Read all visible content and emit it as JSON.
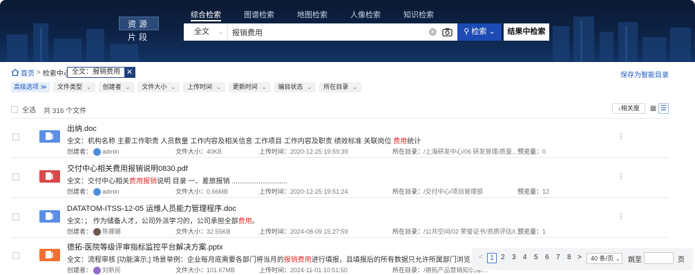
{
  "mode_toggle": [
    "资源",
    "片段"
  ],
  "search_tabs": [
    "综合检索",
    "图谱检索",
    "地图检索",
    "人像检索",
    "知识检索"
  ],
  "search": {
    "scope": "全文",
    "query": "报销费用",
    "button": "检索",
    "in_results": "结果中检索"
  },
  "breadcrumb": {
    "home": "首页",
    "sep": ">",
    "center": "检索中心"
  },
  "query_tag": "全文：报销费用",
  "save_smart": "保存为智能目录",
  "filters": {
    "advanced": "高级选项 ≫",
    "items": [
      "文件类型",
      "创建者",
      "文件大小",
      "上传时间",
      "更新时间",
      "编目状态",
      "所在目录"
    ]
  },
  "list_head": {
    "select_all": "全选",
    "count": "共 316 个文件",
    "sort": "相关度"
  },
  "rows": [
    {
      "type": "word",
      "title": "出纳.doc",
      "snip_pre": "全文：机构名称 主要工作职责 人员数量 工作内容及相关信息 工作项目 工作内容及职责 绩效标准 关联岗位 ",
      "snip_hl": "费用",
      "snip_post": "统计",
      "creator_label": "创建者：",
      "creator": "admin",
      "size_label": "文件大小：",
      "size": "40KB",
      "upload_label": "上传时间：",
      "upload": "2020-12-25 19:59:39",
      "dir_label": "所在目录：",
      "dir": "/上海研发中心/06 研发管理/质量...",
      "views_label": "预览量：",
      "views": "0"
    },
    {
      "type": "pdf",
      "title": "交付中心相关费用报销说明0830.pdf",
      "snip_pre": "全文：交付中心相关",
      "snip_hl": "费用报销",
      "snip_post": "说明 目录 一、差旅报销 .............................",
      "creator_label": "创建者：",
      "creator": "admin",
      "size_label": "文件大小：",
      "size": "0.66MB",
      "upload_label": "上传时间：",
      "upload": "2020-12-25 19:51:24",
      "dir_label": "所在目录：",
      "dir": "/交付中心/项目管理部",
      "views_label": "预览量：",
      "views": "12"
    },
    {
      "type": "word",
      "title": "DATATOM-ITSS-12-05 运维人员能力管理程序.doc",
      "snip_pre": "全文：；  作为储备人才，公司外派学习的，公司承担全部",
      "snip_hl": "费用",
      "snip_post": "。",
      "creator_label": "创建者：",
      "creator": "陈娜娜",
      "size_label": "文件大小：",
      "size": "32.55KB",
      "upload_label": "上传时间：",
      "upload": "2024-08-09 15:27:59",
      "dir_label": "所在目录：",
      "dir": "/公共空间/02 荣誉证书/资质评估/I...",
      "views_label": "预览量：",
      "views": "1"
    },
    {
      "type": "ppt",
      "title": "德拓-医院等级评审指标监控平台解决方案.pptx",
      "snip_pre": "全文：流程审核 [功能演示;] 场景举例：企业每月底需要各部门将当月的",
      "snip_hl": "报销费用",
      "snip_post": "进行填报，且填报后的所有数据只允许所属部门浏览",
      "creator_label": "创建者：",
      "creator": "刘新民",
      "size_label": "文件大小：",
      "size": "101.67MB",
      "upload_label": "上传时间：",
      "upload": "2024-11-01 10:51:50",
      "dir_label": "所在目录：",
      "dir": "/德拓产品营销知识库/..."
    }
  ],
  "pager": {
    "prev": "<",
    "current": "1",
    "pages": [
      "2",
      "3",
      "4",
      "5",
      "6",
      "7",
      "8"
    ],
    "next": ">",
    "size": "40 条/页",
    "jump": "跳至",
    "unit": "页"
  }
}
